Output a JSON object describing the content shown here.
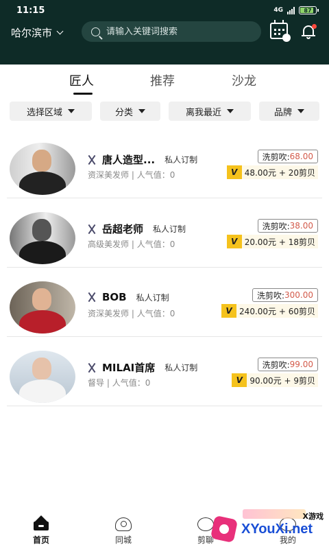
{
  "status": {
    "time": "11:15",
    "network": "4G",
    "battery": "87"
  },
  "header": {
    "city": "哈尔滨市",
    "search_placeholder": "请输入关键词搜索"
  },
  "tabs": [
    {
      "label": "匠人",
      "active": true
    },
    {
      "label": "推荐",
      "active": false
    },
    {
      "label": "沙龙",
      "active": false
    }
  ],
  "filters": [
    {
      "label": "选择区域"
    },
    {
      "label": "分类"
    },
    {
      "label": "离我最近"
    },
    {
      "label": "品牌"
    }
  ],
  "stylists": [
    {
      "name": "唐人造型...",
      "tag": "私人订制",
      "title": "资深美发师",
      "popularity": "人气值：0",
      "service": "洗剪吹:",
      "price": "68.00",
      "vip": "48.00元 + 20剪贝"
    },
    {
      "name": "岳超老师",
      "tag": "私人订制",
      "title": "高级美发师",
      "popularity": "人气值：0",
      "service": "洗剪吹:",
      "price": "38.00",
      "vip": "20.00元 + 18剪贝"
    },
    {
      "name": "BOB",
      "tag": "私人订制",
      "title": "资深美发师",
      "popularity": "人气值：0",
      "service": "洗剪吹:",
      "price": "300.00",
      "vip": "240.00元 + 60剪贝"
    },
    {
      "name": "MILAI首席",
      "tag": "私人订制",
      "title": "督导",
      "popularity": "人气值：0",
      "service": "洗剪吹:",
      "price": "99.00",
      "vip": "90.00元 + 9剪贝"
    }
  ],
  "bottom_nav": [
    {
      "label": "首页",
      "icon": "home-icon",
      "active": true
    },
    {
      "label": "同城",
      "icon": "location-icon",
      "active": false
    },
    {
      "label": "剪聊",
      "icon": "chat-icon",
      "active": false
    },
    {
      "label": "我的",
      "icon": "user-icon",
      "active": false
    }
  ],
  "watermark": {
    "small": "X游戏",
    "text": "XYouXi.net"
  },
  "colors": {
    "header_bg": "#0e2b27",
    "price_red": "#d35a4a",
    "vip_yellow": "#f5c21c"
  }
}
